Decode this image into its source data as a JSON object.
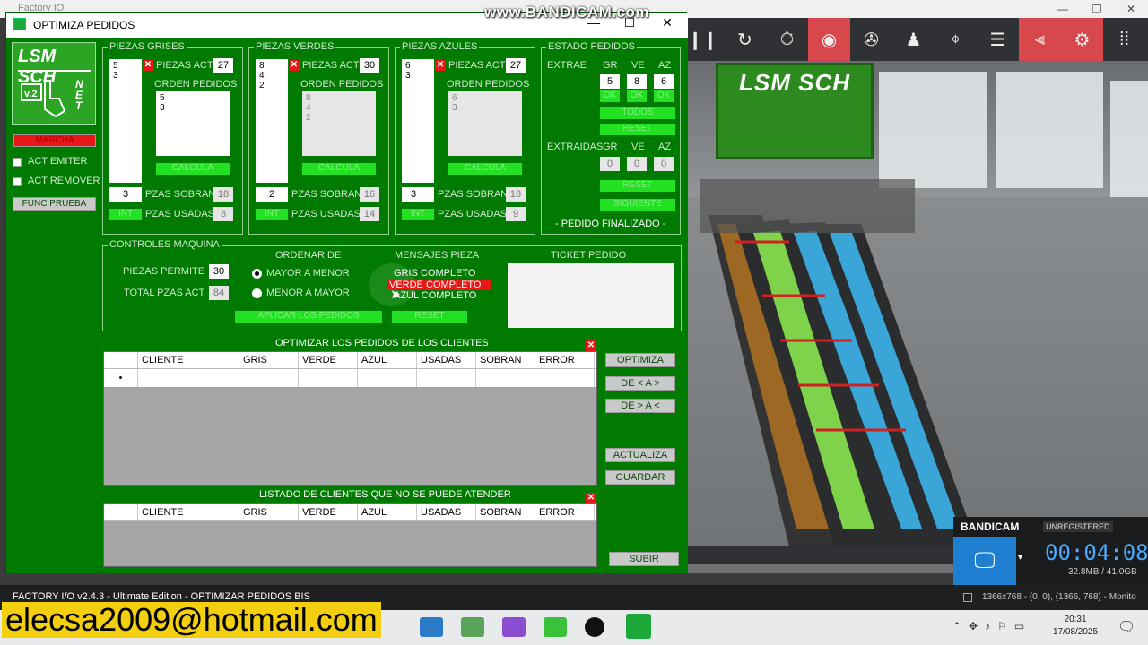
{
  "background_app": {
    "title": "Factory IO"
  },
  "watermark": "www.BANDICAM.com",
  "window": {
    "title": "OPTIMIZA PEDIDOS",
    "controls": {
      "min": "—",
      "max": "☐",
      "close": "✕"
    }
  },
  "logo": {
    "line1": "LSM SCH",
    "version": "v.2",
    "net": "NET"
  },
  "side": {
    "marcha_label": "MARCHA",
    "act_emiter": "ACT EMITER",
    "act_remover": "ACT REMOVER",
    "func_prueba": "FUNC PRUEBA"
  },
  "groups": [
    {
      "title": "PIEZAS GRISES",
      "list": "5\n3",
      "piezas_act_label": "PIEZAS ACT",
      "piezas_act": "27",
      "orden_label": "ORDEN PEDIDOS",
      "orden": "5\n3",
      "orden_dim": false,
      "calcula": "CALCULA",
      "input_value": "3",
      "sobran_label": "PZAS SOBRAN",
      "sobran": "18",
      "int_label": "INT",
      "usadas_label": "PZAS USADAS",
      "usadas": "8"
    },
    {
      "title": "PIEZAS VERDES",
      "list": "8\n4\n2",
      "piezas_act_label": "PIEZAS ACT",
      "piezas_act": "30",
      "orden_label": "ORDEN PEDIDOS",
      "orden": "8\n4\n2",
      "orden_dim": true,
      "calcula": "CALCULA",
      "input_value": "2",
      "sobran_label": "PZAS SOBRAN",
      "sobran": "16",
      "int_label": "INT",
      "usadas_label": "PZAS USADAS",
      "usadas": "14"
    },
    {
      "title": "PIEZAS AZULES",
      "list": "6\n3",
      "piezas_act_label": "PIEZAS ACT",
      "piezas_act": "27",
      "orden_label": "ORDEN PEDIDOS",
      "orden": "6\n3",
      "orden_dim": true,
      "calcula": "CALCULA",
      "input_value": "3",
      "sobran_label": "PZAS SOBRAN",
      "sobran": "18",
      "int_label": "INT",
      "usadas_label": "PZAS USADAS",
      "usadas": "9"
    }
  ],
  "estado": {
    "title": "ESTADO PEDIDOS",
    "extrae": "EXTRAE",
    "gr": "GR",
    "ve": "VE",
    "az": "AZ",
    "extrae_vals": [
      "5",
      "8",
      "6"
    ],
    "ok": "OK",
    "todos": "TODOS",
    "reset": "RESET",
    "extraidas": "EXTRAIDAS",
    "extraidas_vals": [
      "0",
      "0",
      "0"
    ],
    "siguiente": "SIGUIENTE",
    "finalizado": "-  PEDIDO FINALIZADO  -"
  },
  "controles": {
    "title": "CONTROLES MAQUINA",
    "piezas_permite_label": "PIEZAS PERMITE",
    "piezas_permite": "30",
    "total_label": "TOTAL PZAS ACT",
    "total": "84",
    "ordenar_label": "ORDENAR DE",
    "mayor_menor": "MAYOR A MENOR",
    "menor_mayor": "MENOR A MAYOR",
    "aplicar": "APLICAR LOS PEDIDOS",
    "mensajes_label": "MENSAJES PIEZA",
    "msg_gris": "GRIS COMPLETO",
    "msg_verde": "VERDE COMPLETO",
    "msg_azul": "AZUL COMPLETO",
    "reset": "RESET",
    "ticket_label": "TICKET PEDIDO"
  },
  "optimizar": {
    "title": "OPTIMIZAR LOS PEDIDOS DE LOS CLIENTES",
    "columns": [
      "",
      "CLIENTE",
      "GRIS",
      "VERDE",
      "AZUL",
      "USADAS",
      "SOBRAN",
      "ERROR"
    ],
    "new_row_marker": "•",
    "buttons": {
      "optimiza": "OPTIMIZA",
      "asc": "DE < A >",
      "desc": "DE > A <",
      "actualiza": "ACTUALIZA",
      "guardar": "GUARDAR"
    }
  },
  "listado": {
    "title": "LISTADO DE CLIENTES QUE NO SE PUEDE ATENDER",
    "columns": [
      "",
      "CLIENTE",
      "GRIS",
      "VERDE",
      "AZUL",
      "USADAS",
      "SOBRAN",
      "ERROR"
    ],
    "subir": "SUBIR"
  },
  "bandicam": {
    "brand": "BANDICAM",
    "unregistered": "UNREGISTERED",
    "timer": "00:04:08",
    "size": "32.8MB / 41.0GB"
  },
  "status_bar": {
    "left": "FACTORY I/O v2.4.3 - Ultimate Edition - OPTIMIZAR PEDIDOS BIS",
    "right": "1366x768 - (0, 0), (1366, 768) - Monito"
  },
  "email_overlay": "elecsa2009@hotmail.com",
  "taskbar": {
    "time": "20:31",
    "date": "17/08/2025"
  },
  "colors": {
    "app_green": "#007a00",
    "bright_green": "#22e022",
    "red": "#e81818",
    "toolbar_red": "#d8474b",
    "bandicam_blue": "#1e7fd1"
  }
}
